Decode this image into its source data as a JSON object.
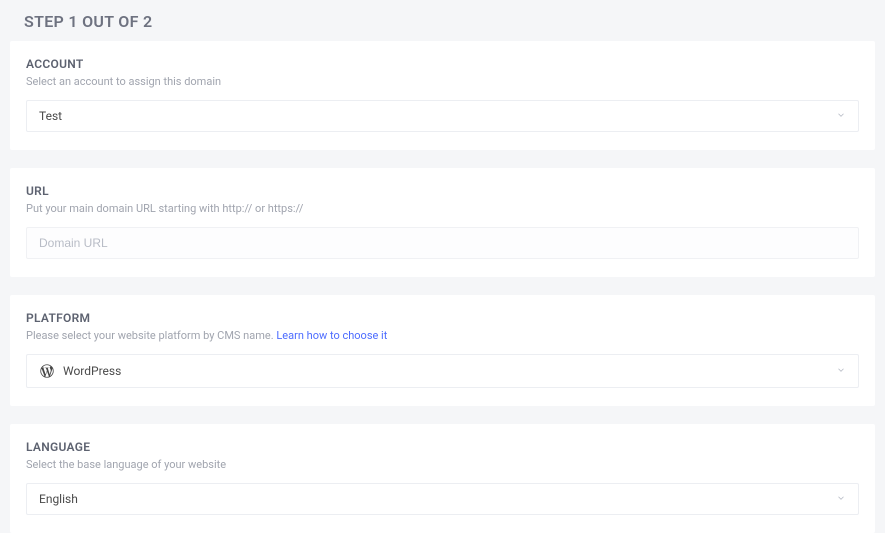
{
  "page": {
    "title": "STEP 1 OUT OF 2"
  },
  "account": {
    "label": "ACCOUNT",
    "hint": "Select an account to assign this domain",
    "value": "Test"
  },
  "url": {
    "label": "URL",
    "hint": "Put your main domain URL starting with http:// or https://",
    "placeholder": "Domain URL",
    "value": ""
  },
  "platform": {
    "label": "PLATFORM",
    "hint_prefix": "Please select your website platform by CMS name.  ",
    "hint_link": "Learn how to choose it",
    "value": "WordPress"
  },
  "language": {
    "label": "LANGUAGE",
    "hint": "Select the base language of your website",
    "value": "English"
  }
}
